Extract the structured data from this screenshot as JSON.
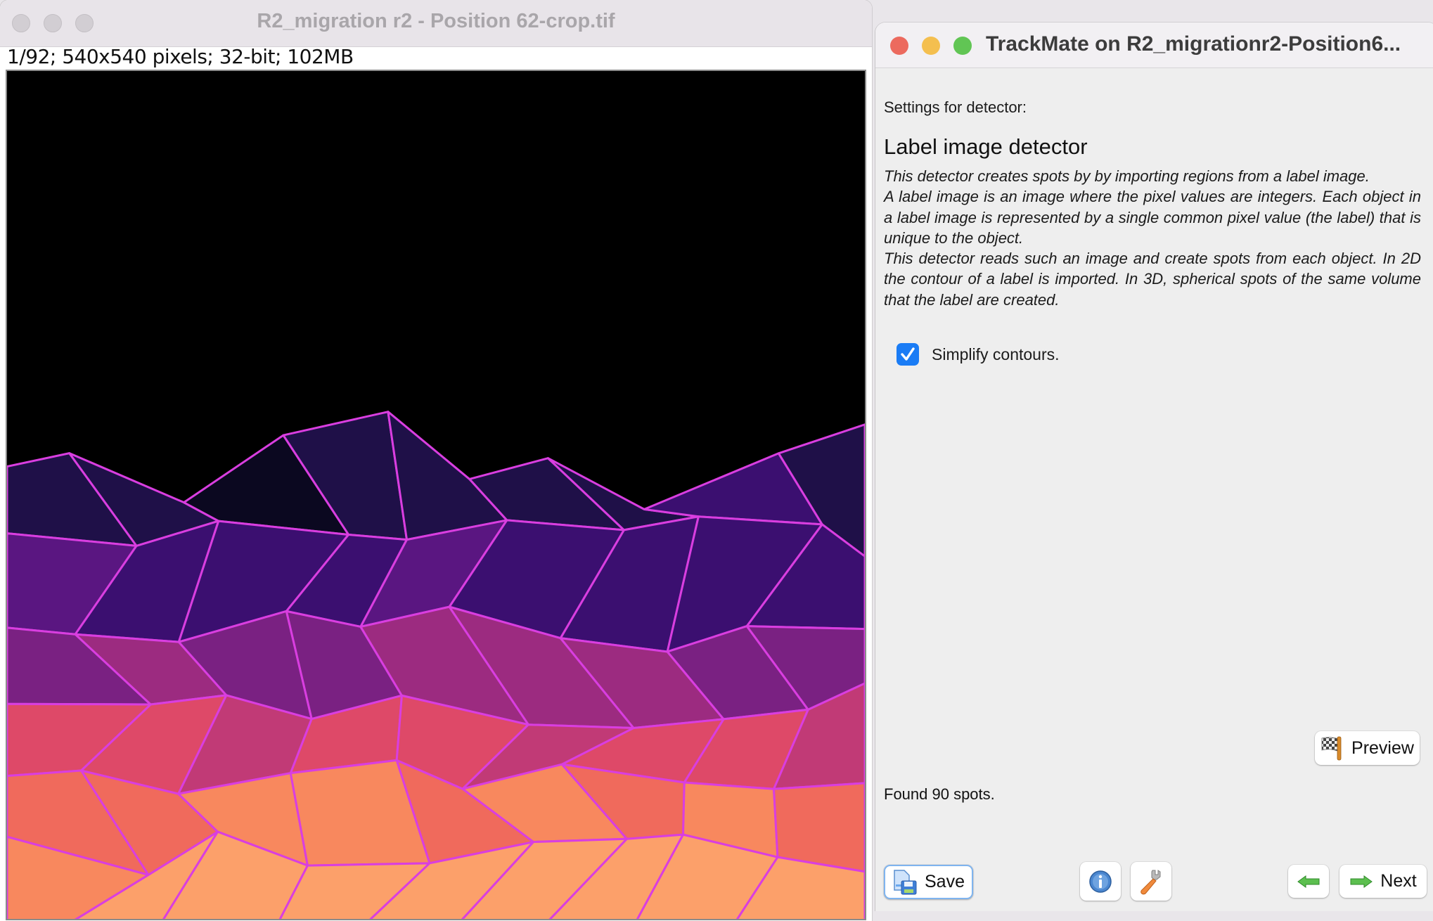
{
  "image_window": {
    "title": "R2_migration r2 - Position 62-crop.tif",
    "info_line": "1/92; 540x540 pixels; 32-bit; 102MB",
    "controls": [
      "close",
      "minimize",
      "zoom"
    ],
    "canvas": {
      "description": "Label image of segmented cells with magenta contours, magma-like colormap",
      "background": "#000000",
      "contour_color": "#d93ee0",
      "colormap_stops": [
        "#0b0820",
        "#1f1048",
        "#3b0f70",
        "#5a1681",
        "#7a2182",
        "#9c2b80",
        "#c13a76",
        "#de4968",
        "#f06a5c",
        "#f8885e",
        "#fca06a"
      ]
    }
  },
  "trackmate_window": {
    "title": "TrackMate on R2_migrationr2-Position6...",
    "controls": {
      "close_color": "#ec6a5e",
      "minimize_color": "#f4bf4f",
      "zoom_color": "#61c554"
    },
    "settings_label": "Settings for detector:",
    "detector_title": "Label image detector",
    "description": [
      "This detector creates spots by by importing regions from a label image.",
      "A label image is an image where the pixel values are integers. Each object in a label image is represented by a single common pixel value (the label) that is unique to the object.",
      "This detector reads such an image and create spots from each object. In 2D the contour of a label is imported. In 3D, spherical spots of the same volume that the label are created."
    ],
    "simplify_contours": {
      "label": "Simplify contours.",
      "checked": true
    },
    "preview_button": {
      "label": "Preview",
      "icon": "checkered-flag-icon"
    },
    "status": "Found 90 spots.",
    "footer": {
      "save_label": "Save",
      "save_icon": "save-floppy-icon",
      "info_icon": "info-icon",
      "settings_icon": "wrench-icon",
      "back_icon": "arrow-left-icon",
      "next_label": "Next",
      "next_icon": "arrow-right-icon"
    },
    "accent_color": "#1a7cf5"
  }
}
